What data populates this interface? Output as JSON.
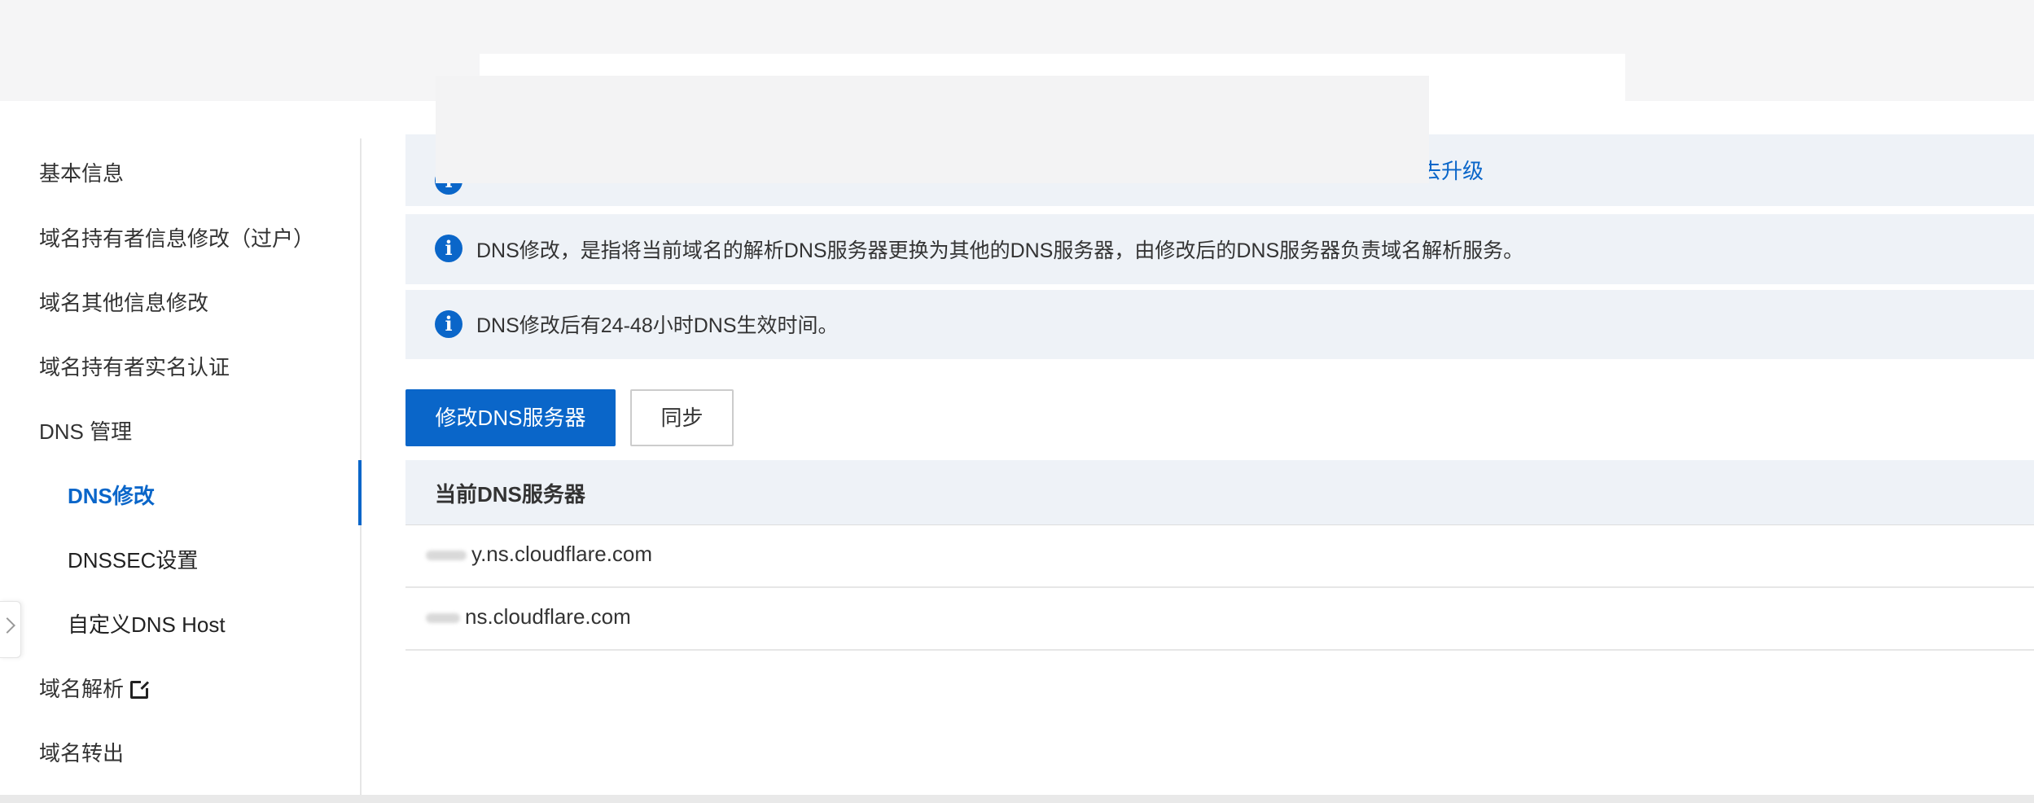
{
  "sidebar": {
    "items": [
      {
        "label": "基本信息"
      },
      {
        "label": "域名持有者信息修改（过户）"
      },
      {
        "label": "域名其他信息修改"
      },
      {
        "label": "域名持有者实名认证"
      },
      {
        "label": "DNS 管理"
      },
      {
        "label": "DNS修改",
        "active": true
      },
      {
        "label": "DNSSEC设置"
      },
      {
        "label": "自定义DNS Host"
      },
      {
        "label": "域名解析",
        "icon": "external-link-icon"
      },
      {
        "label": "域名转出"
      }
    ]
  },
  "alerts": {
    "upgrade_link": "去升级",
    "dns_change_info": "DNS修改，是指将当前域名的解析DNS服务器更换为其他的DNS服务器，由修改后的DNS服务器负责域名解析服务。",
    "dns_effective_time": "DNS修改后有24-48小时DNS生效时间。",
    "icon": "info-icon"
  },
  "toolbar": {
    "modify_label": "修改DNS服务器",
    "sync_label": "同步"
  },
  "table": {
    "header": "当前DNS服务器",
    "rows": [
      {
        "value": "y.ns.cloudflare.com"
      },
      {
        "value": "ns.cloudflare.com"
      }
    ]
  },
  "colors": {
    "accent": "#0a66c9",
    "alert_bg": "#eef2f7"
  }
}
